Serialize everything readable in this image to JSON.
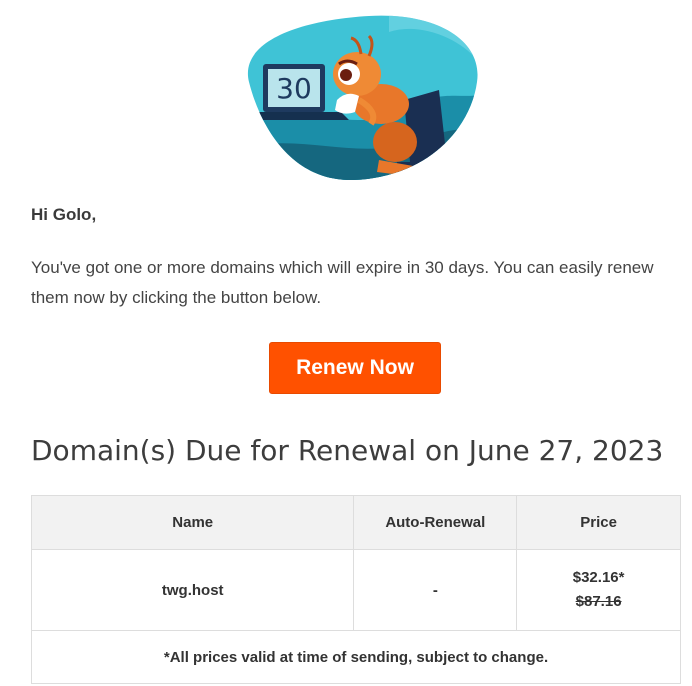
{
  "hero": {
    "counter": "30",
    "icon": "ant-at-laptop-illustration"
  },
  "greeting": "Hi Golo,",
  "intro": "You've got one or more domains which will expire in 30 days. You can easily renew them now by clicking the button below.",
  "renew_button": {
    "label": "Renew Now",
    "color": "#ff5100"
  },
  "section_title": "Domain(s) Due for Renewal on June 27, 2023",
  "table": {
    "headers": {
      "name": "Name",
      "auto_renewal": "Auto-Renewal",
      "price": "Price"
    },
    "rows": [
      {
        "name": "twg.host",
        "auto_renewal": "-",
        "price_current": "$32.16*",
        "price_old": "$87.16"
      }
    ],
    "footnote": "*All prices valid at time of sending, subject to change."
  }
}
